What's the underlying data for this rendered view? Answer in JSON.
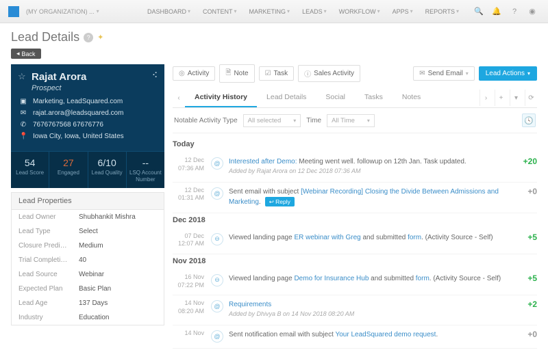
{
  "header": {
    "org": "(MY ORGANIZATION) ...",
    "nav": [
      "DASHBOARD",
      "CONTENT",
      "MARKETING",
      "LEADS",
      "WORKFLOW",
      "APPS",
      "REPORTS"
    ]
  },
  "page": {
    "title": "Lead Details",
    "back": "Back"
  },
  "lead": {
    "name": "Rajat Arora",
    "stage": "Prospect",
    "company": "Marketing, LeadSquared.com",
    "email": "rajat.arora@leadsquared.com",
    "phone": "7676767568 67676776",
    "location": "Iowa City, Iowa, United States",
    "stats": [
      {
        "val": "54",
        "lbl": "Lead Score"
      },
      {
        "val": "27",
        "lbl": "Engaged",
        "warn": true
      },
      {
        "val": "6/10",
        "lbl": "Lead Quality"
      },
      {
        "val": "--",
        "lbl": "LSQ Account Number"
      }
    ]
  },
  "props": {
    "head": "Lead Properties",
    "rows": [
      {
        "k": "Lead Owner",
        "v": "Shubhankit Mishra"
      },
      {
        "k": "Lead Type",
        "v": "Select"
      },
      {
        "k": "Closure Predi…",
        "v": "Medium"
      },
      {
        "k": "Trial Completi…",
        "v": "40"
      },
      {
        "k": "Lead Source",
        "v": "Webinar"
      },
      {
        "k": "Expected Plan",
        "v": "Basic Plan"
      },
      {
        "k": "Lead Age",
        "v": "137 Days"
      },
      {
        "k": "Industry",
        "v": "Education"
      }
    ]
  },
  "actions": {
    "activity": "Activity",
    "note": "Note",
    "task": "Task",
    "sales": "Sales Activity",
    "sendEmail": "Send Email",
    "leadActions": "Lead Actions"
  },
  "tabs": [
    "Activity History",
    "Lead Details",
    "Social",
    "Tasks",
    "Notes"
  ],
  "filter": {
    "typeLabel": "Notable Activity Type",
    "typeValue": "All selected",
    "timeLabel": "Time",
    "timeValue": "All Time"
  },
  "feed": [
    {
      "group": "Today",
      "items": [
        {
          "date": "12 Dec",
          "time": "07:36 AM",
          "icon": "@",
          "title": "Interested after Demo:",
          "text": " Meeting went well. followup on 12th Jan. Task updated.",
          "by": "Added by Rajat Arora on 12 Dec 2018 07:36 AM",
          "score": "+20"
        },
        {
          "date": "12 Dec",
          "time": "01:31 AM",
          "icon": "@",
          "pre": "Sent email with subject ",
          "link": "[Webinar Recording] Closing the Divide Between Admissions and Marketing",
          "post": ".",
          "reply": "Reply",
          "score": "+0",
          "zero": true
        }
      ]
    },
    {
      "group": "Dec 2018",
      "items": [
        {
          "date": "07 Dec",
          "time": "12:07 AM",
          "icon": "⊖",
          "pre": "Viewed landing page ",
          "link": "ER webinar with Greg",
          "mid": " and submitted ",
          "link2": "form",
          "post": ". (Activity Source - Self)",
          "score": "+5"
        }
      ]
    },
    {
      "group": "Nov 2018",
      "items": [
        {
          "date": "16 Nov",
          "time": "07:22 PM",
          "icon": "⊖",
          "pre": "Viewed landing page ",
          "link": "Demo for Insurance Hub",
          "mid": " and submitted ",
          "link2": "form",
          "post": ". (Activity Source - Self)",
          "score": "+5"
        },
        {
          "date": "14 Nov",
          "time": "08:20 AM",
          "icon": "@",
          "link": "Requirements",
          "by": "Added by Dhivya B on 14 Nov 2018 08:20 AM",
          "score": "+2"
        },
        {
          "date": "14 Nov",
          "time": "",
          "icon": "@",
          "pre": "Sent notification email with subject ",
          "link": "Your LeadSquared demo request",
          "post": ".",
          "score": "+0",
          "zero": true
        }
      ]
    }
  ]
}
